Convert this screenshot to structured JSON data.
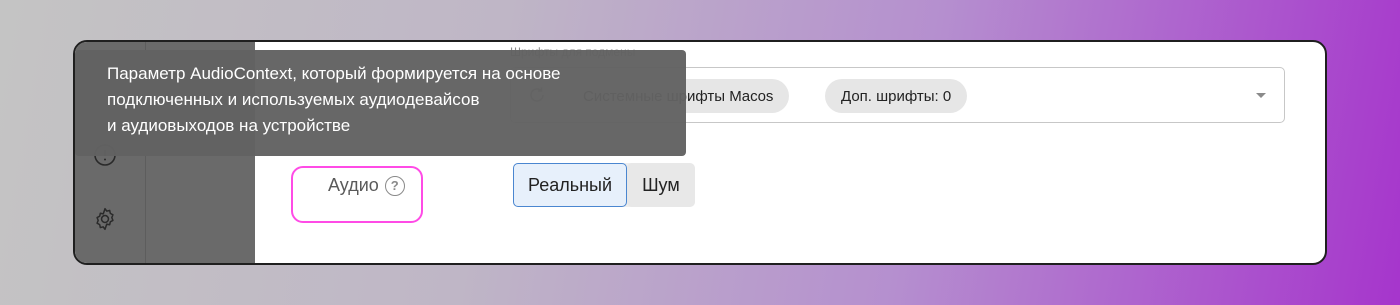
{
  "tooltip": {
    "line1": "Параметр AudioContext, который формируется на основе",
    "line2": "подключенных и используемых аудиодевайсов",
    "line3": "и аудиовыходов на устройстве"
  },
  "fonts": {
    "label": "Шрифты для подмены",
    "chip_system": "Системные шрифты Macos",
    "chip_extra": "Доп. шрифты: 0"
  },
  "audio": {
    "label": "Аудио",
    "help_glyph": "?",
    "options": [
      "Реальный",
      "Шум"
    ],
    "selected": "Реальный"
  },
  "colors": {
    "highlight": "#ff4be6",
    "active_border": "#4a86d0",
    "tooltip_bg": "#626262"
  },
  "icons": [
    "reload-icon",
    "info-icon",
    "settings-icon",
    "help-icon",
    "chevron-down-icon"
  ]
}
